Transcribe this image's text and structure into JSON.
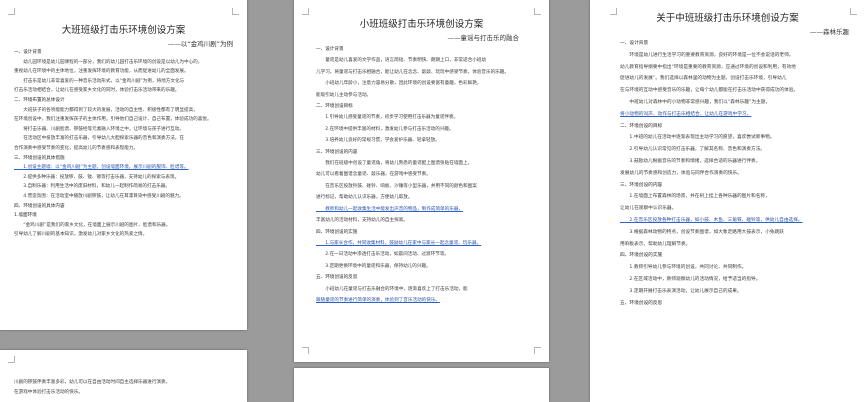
{
  "documents": [
    {
      "id": "doc1",
      "title": "大班班级打击乐环境创设方案",
      "subtitle": "——以“金鸡川剧”为例",
      "lines": [
        {
          "text": "一、设计背景",
          "type": "heading"
        },
        {
          "text": "　　幼儿园环境是幼儿园课程的一部分，我们的幼儿园打击乐环境的创设是以幼儿为中心的，",
          "type": "body"
        },
        {
          "text": "重视幼儿在环境中的主体地位，注重发挥环境的教育功能，从而促进幼儿的全面发展。",
          "type": "body"
        },
        {
          "text": "　　打击乐是幼儿非常喜爱的一种音乐活动形式，以“金鸡川剧”为例，将地方文化与",
          "type": "body"
        },
        {
          "text": "打击乐活动相结合，让幼儿在感受家乡文化的同时，体验打击乐活动带来的乐趣。",
          "type": "body"
        },
        {
          "text": "二、环境布置的总体设计",
          "type": "heading"
        },
        {
          "text": "　　大班孩子的各项能能力都得到了较大的发展，活动的自主性、积极性都有了明显提高，",
          "type": "body"
        },
        {
          "text": "在环境创设中，我们注重发挥孩子的主体作用，引导他们自己设计、自己布置，体验成功的喜悦。",
          "type": "body"
        },
        {
          "text": "　　将打击乐器、川剧脸谱、锣鼓经等元素融入环境之中，让环境与孩子进行互动。",
          "type": "body"
        },
        {
          "text": "　　在活动区中投放丰富的打击乐器，引导幼儿大胆探索乐器的音色和演奏方法，在",
          "type": "body"
        },
        {
          "text": "合作演奏中感受节奏的变化，提高幼儿的节奏感和表现能力。",
          "type": "body"
        },
        {
          "text": "三、环境创设的具体措施",
          "type": "heading"
        },
        {
          "text": "　　1.创设主题墙：以“金鸡川剧”为主题，创设墙面环境，展示川剧的服饰、脸谱等。",
          "type": "body",
          "link": true
        },
        {
          "text": "　　2.提供多种乐器：投放锣、鼓、钹、镲等打击乐器，支持幼儿的探索与表现。",
          "type": "body"
        },
        {
          "text": "　　3.自制乐器：利用生活中的废旧材料，和幼儿一起制作简易的打击乐器。",
          "type": "body"
        },
        {
          "text": "　　4.营造氛围：在活动室中播放川剧锣鼓，让幼儿在耳濡目染中感受川剧的魅力。",
          "type": "body"
        },
        {
          "text": "四、环境创设的具体内容",
          "type": "heading"
        },
        {
          "text": "1.墙面环境",
          "type": "heading"
        },
        {
          "text": "　　“金鸡川剧”是我们的家乡文化，在墙面上展示川剧的图片、脸谱和乐器，",
          "type": "body"
        },
        {
          "text": "引导幼儿了解川剧的基本知识，激发幼儿对家乡文化的热爱之情。",
          "type": "body"
        }
      ],
      "continuation": [
        {
          "text": "川剧的锣鼓伴奏丰富多彩，幼儿可以在自由活动时间自主选择乐器进行演奏，",
          "type": "body"
        },
        {
          "text": "在游戏中体验打击乐活动的快乐。",
          "type": "body"
        }
      ]
    },
    {
      "id": "doc2",
      "title": "小班班级打击乐环境创设方案",
      "subtitle": "——童谣与打击乐的融合",
      "lines": [
        {
          "text": "一、设计背景",
          "type": "heading"
        },
        {
          "text": "　　童谣是幼儿喜爱的文学作品，语言简短、节奏明快、朗朗上口，非常适合小班幼",
          "type": "body"
        },
        {
          "text": "儿学习。将童谣与打击乐相融合，能让幼儿在念念、敲敲、玩玩中感受节奏，体验音乐的乐趣。",
          "type": "body"
        },
        {
          "text": "　　小班幼儿年龄小，注意力容易分散，因此环境的创设要富有童趣，色彩鲜艳，",
          "type": "body"
        },
        {
          "text": "能吸引幼儿主动参与活动。",
          "type": "body"
        },
        {
          "text": "二、环境创设目标",
          "type": "heading"
        },
        {
          "text": "　　1.引导幼儿感受童谣的节奏，初步学习使用打击乐器为童谣伴奏。",
          "type": "body"
        },
        {
          "text": "　　2.在环境中提供丰富的材料，激发幼儿参与打击乐活动的兴趣。",
          "type": "body"
        },
        {
          "text": "　　3.培养幼儿良好的常规习惯，学会爱护乐器、轻拿轻放。",
          "type": "body"
        },
        {
          "text": "三、环境创设的内容",
          "type": "heading"
        },
        {
          "text": "　　我们在班级中创设了童谣角，将幼儿熟悉的童谣配上图谱张贴在墙面上，",
          "type": "body"
        },
        {
          "text": "幼儿可以看着图谱念童谣、敲乐器，在游戏中感受节奏。",
          "type": "body"
        },
        {
          "text": "　　在音乐区投放铃鼓、碰铃、响板、沙锤等小型乐器，并用不同的颜色和图案",
          "type": "body"
        },
        {
          "text": "进行标记，帮助幼儿认识乐器，方便幼儿取放。",
          "type": "body"
        },
        {
          "text": "　　教师和幼儿一起收集生活中能发出声音的物品，制作成简单的乐器，",
          "type": "body",
          "link": true
        },
        {
          "text": "丰富幼儿的活动材料，支持幼儿的自主探索。",
          "type": "body"
        },
        {
          "text": "四、环境创设的实施",
          "type": "heading"
        },
        {
          "text": "　　1.与家长合作，共同收集材料，鼓励幼儿在家中与家长一起念童谣、玩乐器。",
          "type": "body",
          "link": true
        },
        {
          "text": "　　2.在一日活动中渗透打击乐活动，如晨间活动、过渡环节等。",
          "type": "body"
        },
        {
          "text": "　　3.定期更换环境中的童谣和乐器，保持幼儿的兴趣。",
          "type": "body"
        },
        {
          "text": "五、环境创设的反思",
          "type": "heading"
        },
        {
          "text": "　　小班幼儿在童谣与打击乐融合的环境中，逐渐喜欢上了打击乐活动，能",
          "type": "body"
        },
        {
          "text": "跟随童谣的节奏进行简单的演奏，体验到了音乐活动的快乐。",
          "type": "body",
          "link": true
        }
      ]
    },
    {
      "id": "doc3",
      "title": "关于中班班级打击乐环境创设方案",
      "subtitle": "——森林乐趣",
      "lines": [
        {
          "text": "一、设计背景",
          "type": "heading"
        },
        {
          "text": "　　环境是幼儿进行生活学习的重要教育资源，良好的环境是一位不会说话的老师。",
          "type": "body"
        },
        {
          "text": "幼儿教育指导纲要中指出“环境是重要的教育资源，应通过环境的创设和利用，有效地",
          "type": "body"
        },
        {
          "text": "促进幼儿的发展”。我们选择以森林里的动物为主题，创设打击乐环境，引导幼儿",
          "type": "body"
        },
        {
          "text": "在与环境的互动中感受音乐的乐趣，让每个幼儿都能在打击乐活动中获得成功的体验。",
          "type": "body"
        },
        {
          "text": "　　中班幼儿对森林中的小动物非常感兴趣，我们以“森林乐趣”为主题，",
          "type": "body"
        },
        {
          "text": "将小动物的叫声、动作与打击乐相结合，让幼儿在游戏中学习。",
          "type": "body",
          "link": true
        },
        {
          "text": "二、环境创设的目标",
          "type": "heading"
        },
        {
          "text": "　　1.中班的幼儿在活动中逐渐表现出主动学习的愿望，喜欢尝试新事物。",
          "type": "body"
        },
        {
          "text": "　　2.引导幼儿认识常见的打击乐器，了解其名称、音色和演奏方法。",
          "type": "body"
        },
        {
          "text": "　　3.鼓励幼儿根据音乐的节奏和情绪，选择合适的乐器进行伴奏，",
          "type": "body"
        },
        {
          "text": "发展幼儿的节奏感和创造力，体验与同伴合作演奏的快乐。",
          "type": "body"
        },
        {
          "text": "三、环境创设的内容",
          "type": "heading"
        },
        {
          "text": "　　1.在墙面上布置森林的场景，并在树上挂上各种乐器的图片和名称，",
          "type": "body"
        },
        {
          "text": "让幼儿在观察中认识乐器。",
          "type": "body"
        },
        {
          "text": "　　2.在音乐区投放各种打击乐器，如小鼓、木鱼、三角铁、碰铃等，供幼儿自由选择。",
          "type": "body",
          "link": true
        },
        {
          "text": "　　3.根据森林动物的特点，创设节奏图谱，如大象走路用大鼓表示，小兔跳跃",
          "type": "body"
        },
        {
          "text": "用响板表示，帮助幼儿理解节奏。",
          "type": "body"
        },
        {
          "text": "四、环境创设的实施",
          "type": "heading"
        },
        {
          "text": "　　1.教师引导幼儿参与环境的创设，共同讨论、共同制作。",
          "type": "body"
        },
        {
          "text": "　　2.在区域活动中，教师观察幼儿的活动情况，给予适当的指导。",
          "type": "body"
        },
        {
          "text": "　　3.定期开展打击乐表演活动，让幼儿展示自己的成果。",
          "type": "body"
        },
        {
          "text": "五、环境创设的反思",
          "type": "heading"
        }
      ]
    }
  ]
}
